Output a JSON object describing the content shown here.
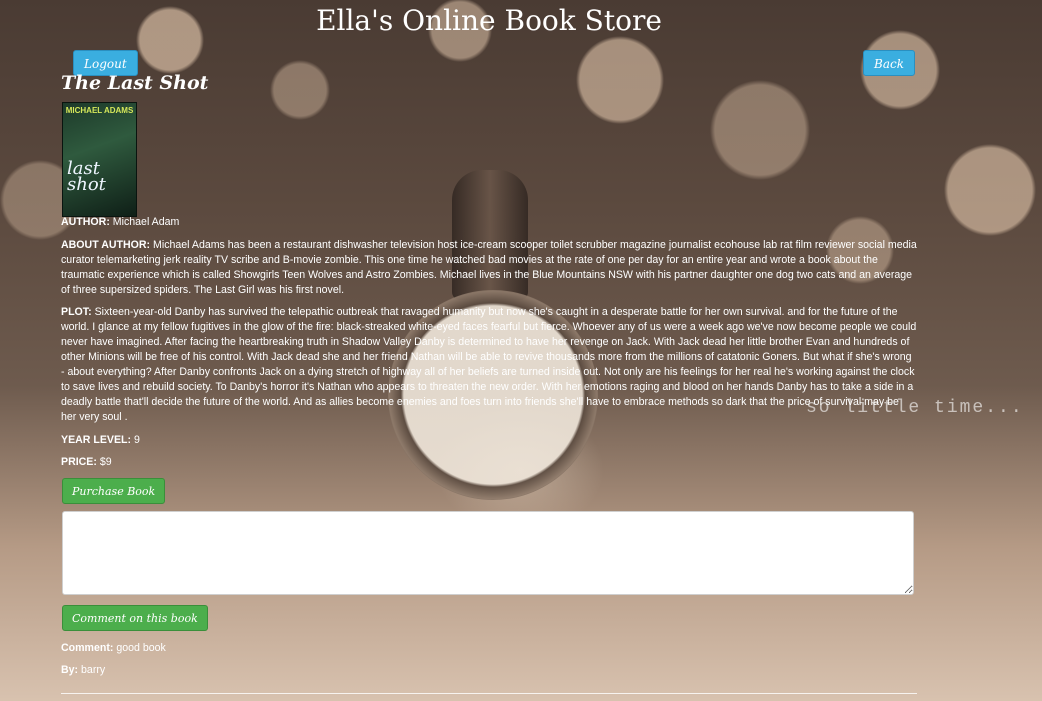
{
  "site_title": "Ella's Online Book Store",
  "nav": {
    "logout_label": "Logout",
    "back_label": "Back"
  },
  "book": {
    "title": "The Last Shot",
    "cover": {
      "author_text": "MICHAEL ADAMS",
      "title_text": "last shot"
    },
    "author_label": "AUTHOR:",
    "author": "Michael Adam",
    "about_label": "ABOUT AUTHOR:",
    "about": "Michael Adams has been a restaurant dishwasher television host ice-cream scooper toilet scrubber magazine journalist ecohouse lab rat film reviewer social media curator telemarketing jerk reality TV scribe and B-movie zombie. This one time he watched bad movies at the rate of one per day for an entire year and wrote a book about the traumatic experience which is called Showgirls Teen Wolves and Astro Zombies. Michael lives in the Blue Mountains NSW with his partner daughter one dog two cats and an average of three supersized spiders. The Last Girl was his first novel.",
    "plot_label": "PLOT:",
    "plot": "Sixteen-year-old Danby has survived the telepathic outbreak that ravaged humanity but now she's caught in a desperate battle for her own survival. and for the future of the world. I glance at my fellow fugitives in the glow of the fire: black-streaked white-eyed faces fearful but fierce. Whoever any of us were a week ago we've now become people we could never have imagined. After facing the heartbreaking truth in Shadow Valley Danby is determined to have her revenge on Jack. With Jack dead her little brother Evan and hundreds of other Minions will be free of his control. With Jack dead she and her friend Nathan will be able to revive thousands more from the millions of catatonic Goners. But what if she's wrong - about everything? After Danby confronts Jack on a dying stretch of highway all of her beliefs are turned inside out. Not only are his feelings for her real he's working against the clock to save lives and rebuild society. To Danby's horror it's Nathan who appears to threaten the new order. With her emotions raging and blood on her hands Danby has to take a side in a deadly battle that'll decide the future of the world. And as allies become enemies and foes turn into friends she'll have to embrace methods so dark that the price of survival may be her very soul .",
    "year_label": "YEAR LEVEL:",
    "year": "9",
    "price_label": "PRICE:",
    "price": "$9"
  },
  "actions": {
    "purchase_label": "Purchase Book",
    "comment_button_label": "Comment on this book",
    "comment_value": ""
  },
  "comments": [
    {
      "comment_label": "Comment:",
      "comment": "good book",
      "by_label": "By:",
      "by": "barry"
    }
  ],
  "background_text": "so little time...",
  "colors": {
    "primary_button": "#3aaee0",
    "success_button": "#4cae4c"
  }
}
